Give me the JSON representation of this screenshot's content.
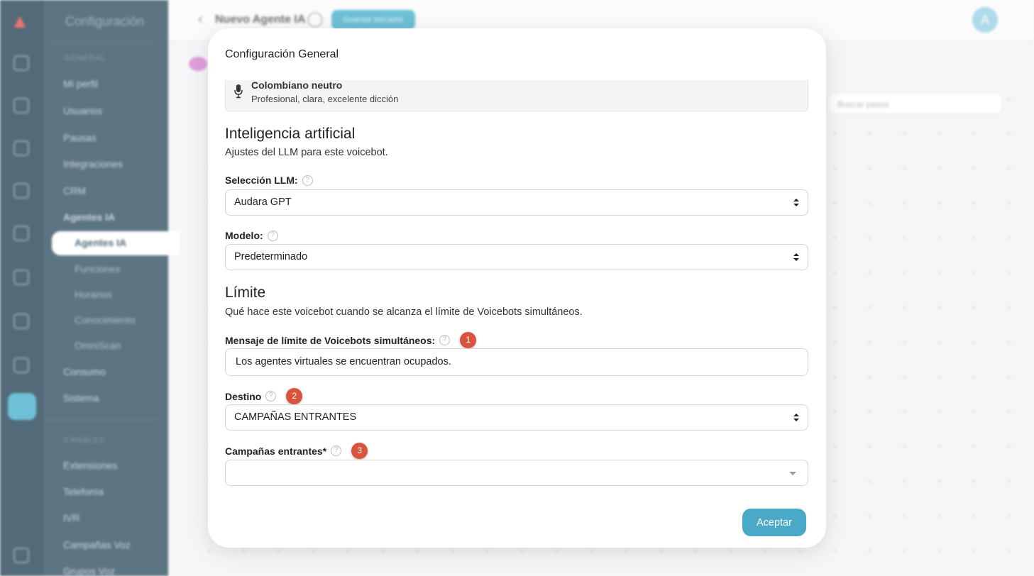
{
  "background": {
    "sidebar_title": "Configuración",
    "section_general": "GENERAL",
    "section_channels": "CANALES",
    "menu": {
      "mi_perfil": "Mi perfil",
      "usuarios": "Usuarios",
      "pausas": "Pausas",
      "integraciones": "Integraciones",
      "crm": "CRM",
      "agentes_ia_group": "Agentes IA",
      "agentes_ia": "Agentes IA",
      "funciones": "Funciones",
      "horarios": "Horarios",
      "conocimiento": "Conocimiento",
      "omniscan": "OmniScan",
      "consumo": "Consumo",
      "sistema": "Sistema",
      "extensiones": "Extensiones",
      "telefonia": "Telefonía",
      "ivr": "IVR",
      "campanas_voz": "Campañas Voz",
      "grupos_voz": "Grupos Voz"
    },
    "page_title": "Nuevo Agente IA",
    "save_draft": "Guardar borrador",
    "avatar_letter": "A",
    "search_steps_placeholder": "Buscar pasos"
  },
  "modal": {
    "title": "Configuración General",
    "voice": {
      "name": "Colombiano neutro",
      "description": "Profesional, clara, excelente dicción"
    },
    "ai_section": {
      "heading": "Inteligencia artificial",
      "description": "Ajustes del LLM para este voicebot."
    },
    "llm": {
      "label": "Selección LLM:",
      "value": "Audara GPT"
    },
    "model": {
      "label": "Modelo:",
      "value": "Predeterminado"
    },
    "limit_section": {
      "heading": "Límite",
      "description": "Qué hace este voicebot cuando se alcanza el límite de Voicebots simultáneos."
    },
    "limit_message": {
      "label": "Mensaje de límite de Voicebots simultáneos:",
      "badge": "1",
      "value": "Los agentes virtuales se encuentran ocupados."
    },
    "destination": {
      "label": "Destino",
      "badge": "2",
      "value": "CAMPAÑAS ENTRANTES"
    },
    "inbound_campaigns": {
      "label": "Campañas entrantes*",
      "badge": "3",
      "value": ""
    },
    "help_glyph": "?",
    "accept_label": "Aceptar"
  }
}
